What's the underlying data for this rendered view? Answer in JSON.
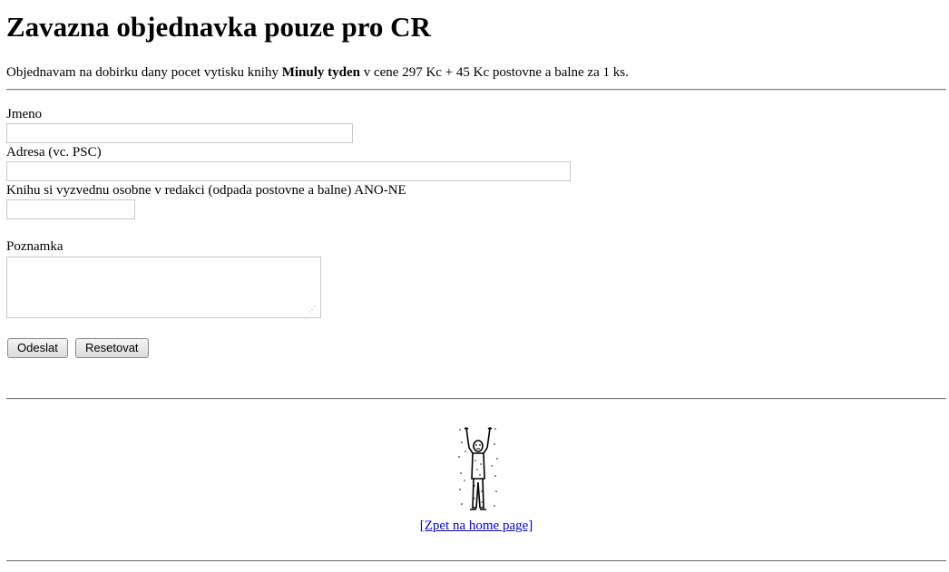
{
  "page": {
    "title": "Zavazna objednavka pouze pro CR",
    "intro": {
      "before": "Objednavam na dobirku dany pocet vytisku knihy ",
      "book_title": "Minuly tyden",
      "after": " v cene 297 Kc + 45 Kc postovne a balne za 1 ks."
    }
  },
  "form": {
    "name_label": "Jmeno",
    "name_value": "",
    "address_label": "Adresa (vc. PSC)",
    "address_value": "",
    "pickup_label": "Knihu si vyzvednu osobne v redakci (odpada postovne a balne) ANO-NE",
    "pickup_value": "",
    "note_label": "Poznamka",
    "note_value": "",
    "submit_label": "Odeslat",
    "reset_label": "Resetovat"
  },
  "footer": {
    "figure_icon": "standing-figure-clipart-icon",
    "home_link": "[Zpet na home page]"
  }
}
